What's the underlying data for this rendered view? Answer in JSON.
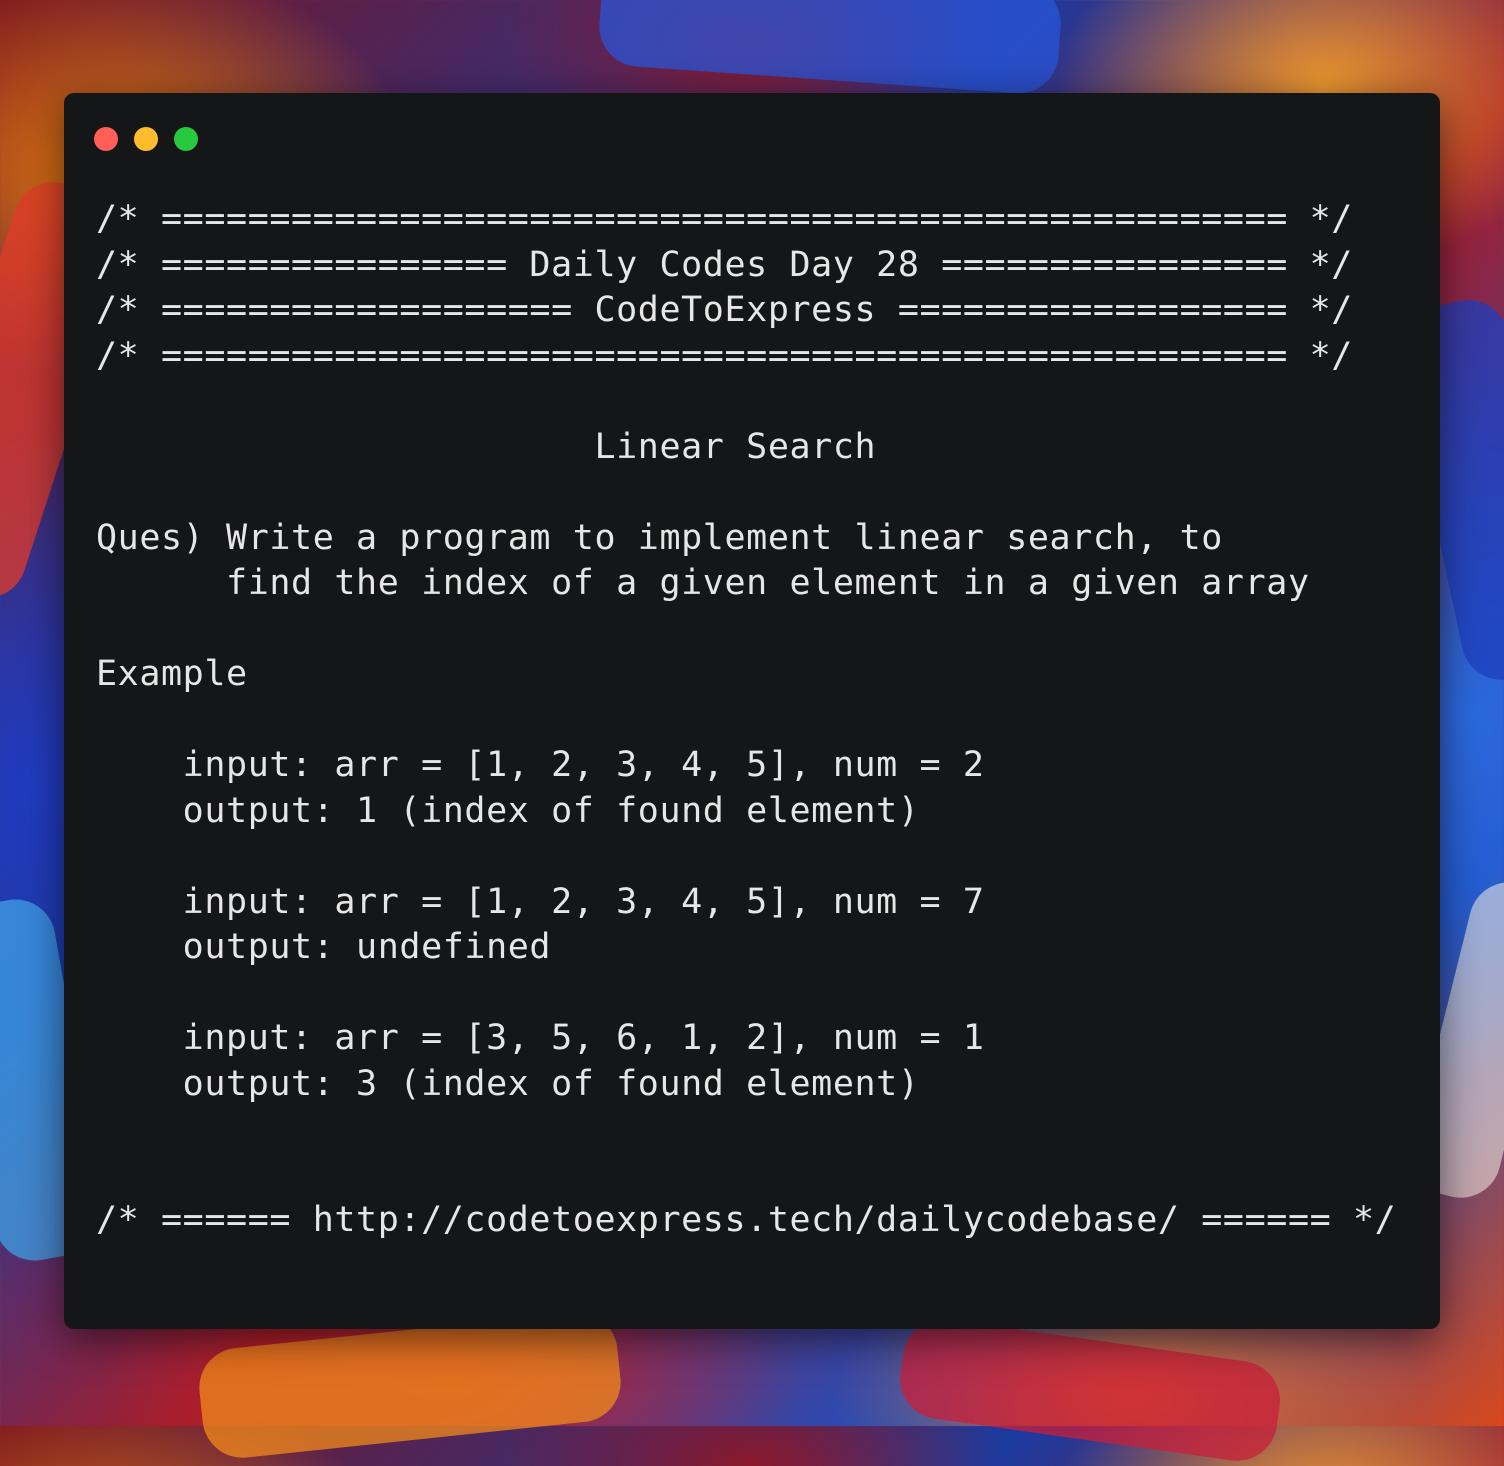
{
  "window": {
    "controls": [
      {
        "name": "close",
        "color": "#ff5f56"
      },
      {
        "name": "minimize",
        "color": "#ffbd2e"
      },
      {
        "name": "maximize",
        "color": "#27c93f"
      }
    ]
  },
  "code_lines": [
    "/* ==================================================== */",
    "/* ================ Daily Codes Day 28 ================ */",
    "/* =================== CodeToExpress ================== */",
    "/* ==================================================== */",
    "",
    "                       Linear Search",
    "",
    "Ques) Write a program to implement linear search, to",
    "      find the index of a given element in a given array",
    "",
    "Example",
    "",
    "    input: arr = [1, 2, 3, 4, 5], num = 2",
    "    output: 1 (index of found element)",
    "",
    "    input: arr = [1, 2, 3, 4, 5], num = 7",
    "    output: undefined",
    "",
    "    input: arr = [3, 5, 6, 1, 2], num = 1",
    "    output: 3 (index of found element)",
    "",
    "",
    "/* ====== http://codetoexpress.tech/dailycodebase/ ====== */"
  ]
}
